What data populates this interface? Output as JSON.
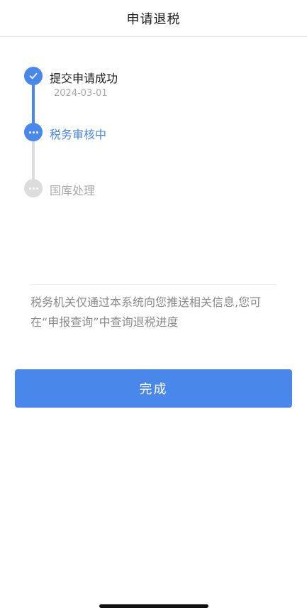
{
  "header": {
    "title": "申请退税"
  },
  "progress": {
    "steps": [
      {
        "label": "提交申请成功",
        "date": "2024-03-01",
        "status": "done",
        "icon": "check-icon"
      },
      {
        "label": "税务审核中",
        "status": "active",
        "icon": "ellipsis-icon"
      },
      {
        "label": "国库处理",
        "status": "pending",
        "icon": "ellipsis-icon"
      }
    ]
  },
  "notice": {
    "text": "税务机关仅通过本系统向您推送相关信息,您可在“申报查询”中查询退税进度"
  },
  "actions": {
    "done_label": "完成"
  },
  "colors": {
    "accent": "#4a87ea",
    "inactive": "#dcdcdc",
    "muted_text": "#a8a8a8"
  }
}
